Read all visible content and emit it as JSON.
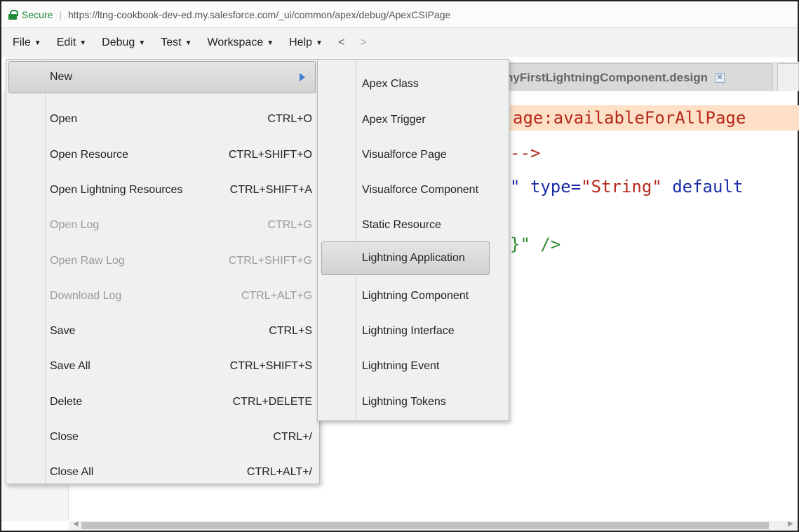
{
  "addressbar": {
    "secure_label": "Secure",
    "url": "https://ltng-cookbook-dev-ed.my.salesforce.com/_ui/common/apex/debug/ApexCSIPage"
  },
  "menubar": {
    "items": [
      "File",
      "Edit",
      "Debug",
      "Test",
      "Workspace",
      "Help"
    ],
    "back": "<",
    "forward": ">"
  },
  "editor": {
    "tab_title": "nyFirstLightningComponent.design",
    "code_lines": [
      "age:availableForAllPage",
      "-->",
      "\" type=",
      "\"String\"",
      " default",
      "}\" />"
    ]
  },
  "file_menu": {
    "items": [
      {
        "label": "New",
        "shortcut": "",
        "state": "highlighted"
      },
      {
        "label": "Open",
        "shortcut": "CTRL+O",
        "state": "enabled"
      },
      {
        "label": "Open Resource",
        "shortcut": "CTRL+SHIFT+O",
        "state": "enabled"
      },
      {
        "label": "Open Lightning Resources",
        "shortcut": "CTRL+SHIFT+A",
        "state": "enabled"
      },
      {
        "label": "Open Log",
        "shortcut": "CTRL+G",
        "state": "disabled"
      },
      {
        "label": "Open Raw Log",
        "shortcut": "CTRL+SHIFT+G",
        "state": "disabled"
      },
      {
        "label": "Download Log",
        "shortcut": "CTRL+ALT+G",
        "state": "disabled"
      },
      {
        "label": "Save",
        "shortcut": "CTRL+S",
        "state": "enabled"
      },
      {
        "label": "Save All",
        "shortcut": "CTRL+SHIFT+S",
        "state": "enabled"
      },
      {
        "label": "Delete",
        "shortcut": "CTRL+DELETE",
        "state": "enabled"
      },
      {
        "label": "Close",
        "shortcut": "CTRL+/",
        "state": "enabled"
      },
      {
        "label": "Close All",
        "shortcut": "CTRL+ALT+/",
        "state": "enabled"
      }
    ]
  },
  "new_submenu": {
    "items": [
      "Apex Class",
      "Apex Trigger",
      "Visualforce Page",
      "Visualforce Component",
      "Static Resource",
      "Lightning Application",
      "Lightning Component",
      "Lightning Interface",
      "Lightning Event",
      "Lightning Tokens"
    ],
    "highlighted_index": 5
  },
  "colors": {
    "secure_green": "#1e8a3a",
    "submenu_arrow_blue": "#3e7fd6",
    "code_red": "#b5291c",
    "code_blue": "#1a2ca5",
    "code_green": "#2f8a2f",
    "code_highlight": "#fde0c6"
  }
}
